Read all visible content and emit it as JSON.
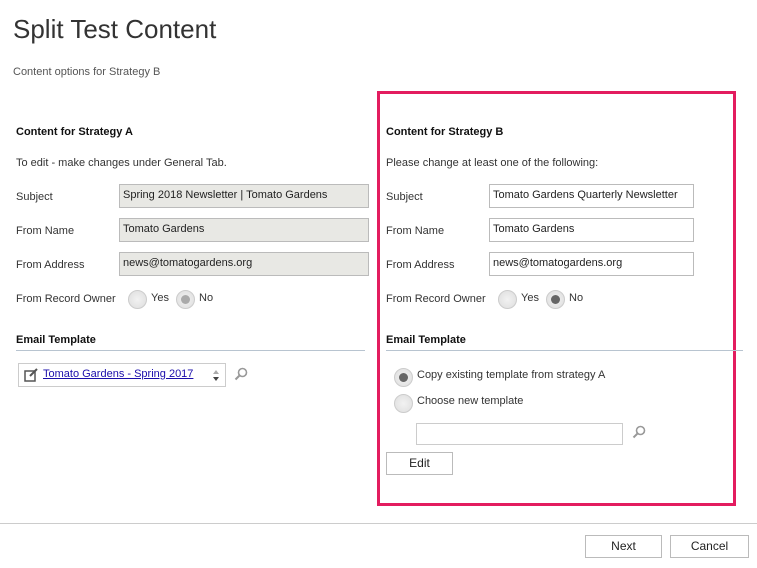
{
  "page": {
    "title": "Split Test Content",
    "subtitle": "Content options for Strategy B"
  },
  "strategy_a": {
    "heading": "Content for Strategy A",
    "note": "To edit - make changes under General Tab.",
    "fields": [
      {
        "label": "Subject",
        "value": "Spring 2018 Newsletter | Tomato Gardens"
      },
      {
        "label": "From Name",
        "value": "Tomato Gardens"
      },
      {
        "label": "From Address",
        "value": "news@tomatogardens.org"
      }
    ],
    "record_owner": {
      "label": "From Record Owner",
      "yes": "Yes",
      "no": "No",
      "selected": "No"
    },
    "template_heading": "Email Template",
    "template_link": "Tomato Gardens - Spring 2017"
  },
  "strategy_b": {
    "heading": "Content for Strategy B",
    "note": "Please change at least one of the following:",
    "fields": [
      {
        "label": "Subject",
        "value": "Tomato Gardens Quarterly Newsletter"
      },
      {
        "label": "From Name",
        "value": "Tomato Gardens"
      },
      {
        "label": "From Address",
        "value": "news@tomatogardens.org"
      }
    ],
    "record_owner": {
      "label": "From Record Owner",
      "yes": "Yes",
      "no": "No",
      "selected": "No"
    },
    "template_heading": "Email Template",
    "option_copy": "Copy existing template from strategy A",
    "option_new": "Choose new template",
    "template_input": "",
    "edit": "Edit"
  },
  "footer": {
    "next": "Next",
    "cancel": "Cancel"
  },
  "colors": {
    "highlight": "#e31c5f"
  }
}
